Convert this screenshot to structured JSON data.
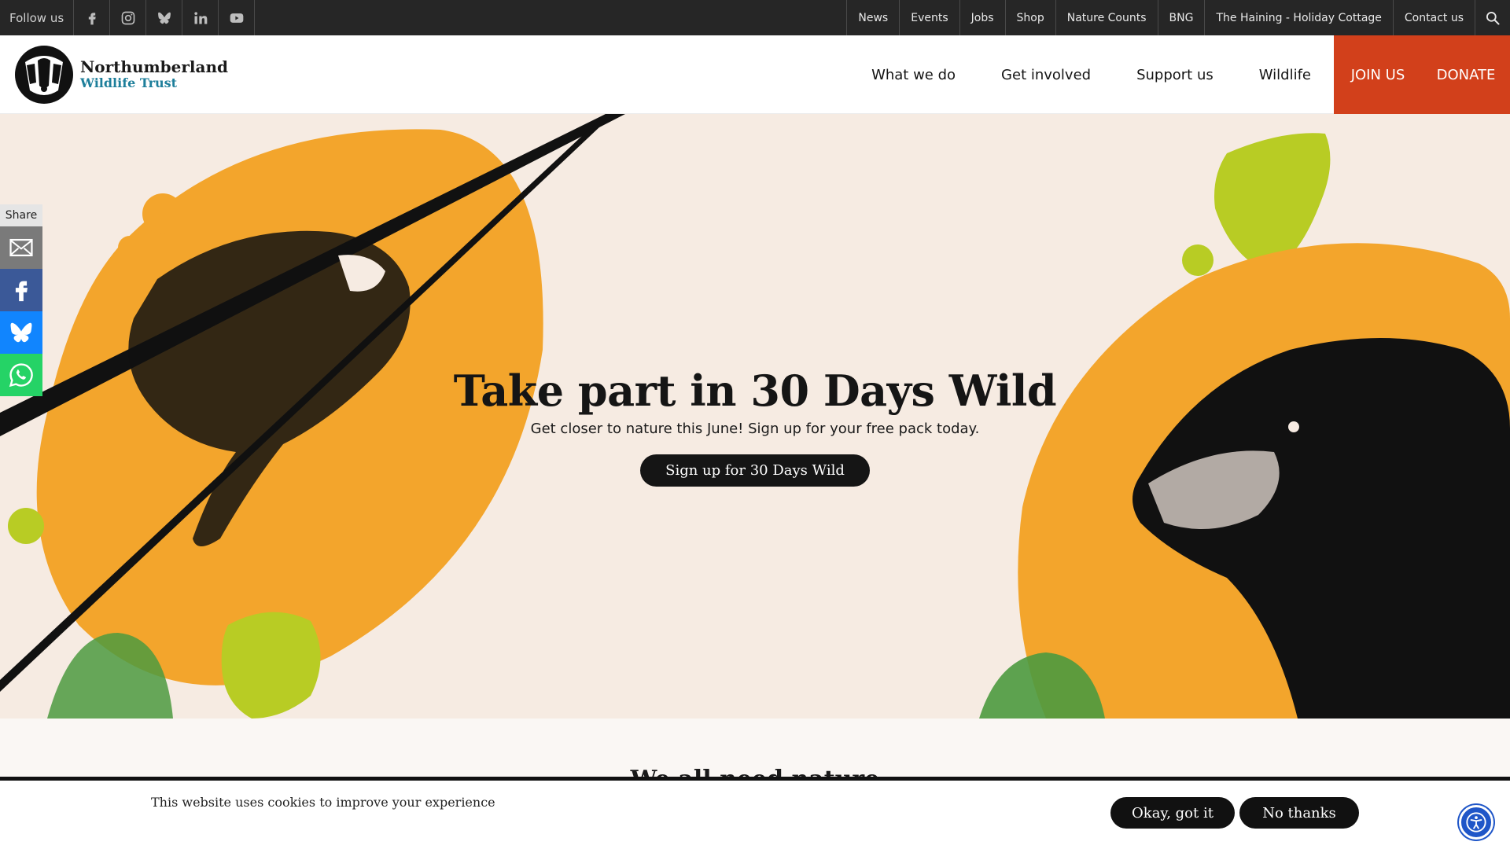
{
  "utility_bar": {
    "follow_label": "Follow us",
    "social_icons": [
      "facebook-icon",
      "instagram-icon",
      "bluesky-icon",
      "linkedin-icon",
      "youtube-icon"
    ],
    "links": [
      "News",
      "Events",
      "Jobs",
      "Shop",
      "Nature Counts",
      "BNG",
      "The Haining - Holiday Cottage",
      "Contact us"
    ],
    "search_icon": "search-icon"
  },
  "header": {
    "logo_line1": "Northumberland",
    "logo_line2": "Wildlife Trust",
    "nav": [
      "What we do",
      "Get involved",
      "Support us",
      "Wildlife"
    ],
    "join_label": "JOIN US",
    "donate_label": "DONATE"
  },
  "hero": {
    "title": "Take part in 30 Days Wild",
    "subtitle": "Get closer to nature this June! Sign up for your free pack today.",
    "button_label": "Sign up for 30 Days Wild"
  },
  "share": {
    "label": "Share",
    "buttons": [
      "email-icon",
      "facebook-icon",
      "bluesky-icon",
      "whatsapp-icon"
    ]
  },
  "section": {
    "heading": "We all need nature"
  },
  "cookie": {
    "message": "This website uses cookies to improve your experience",
    "accept_label": "Okay, got it",
    "decline_label": "No thanks"
  },
  "colors": {
    "brand_orange": "#d2401b",
    "hero_bg": "#f6ebe2",
    "accent_lime": "#b8cc24",
    "accent_amber": "#f3a52c",
    "share_facebook": "#3b5998",
    "share_bluesky": "#1185fe",
    "share_whatsapp": "#25d366"
  }
}
